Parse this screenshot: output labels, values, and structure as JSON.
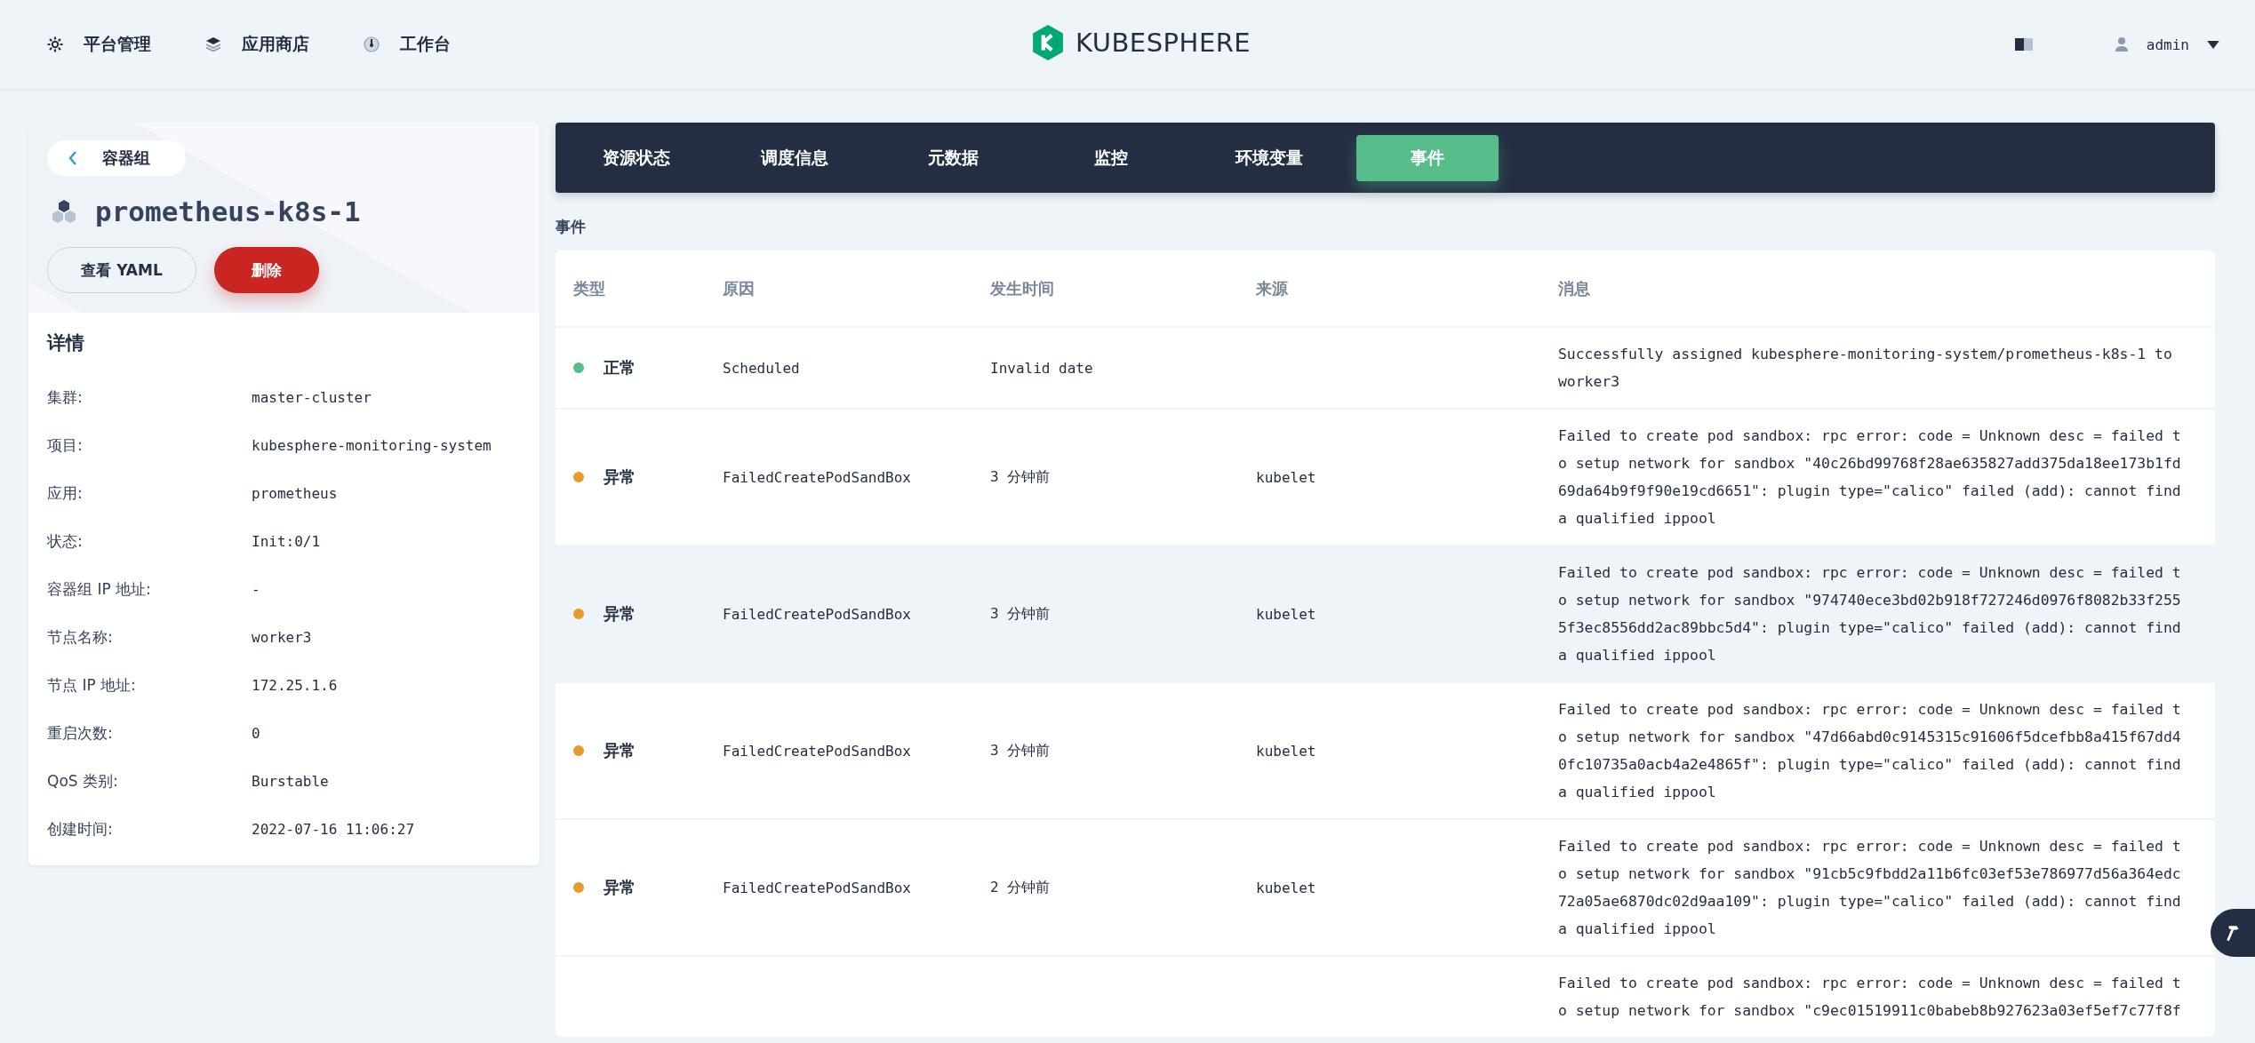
{
  "top_nav": {
    "items": [
      {
        "label": "平台管理",
        "kind": "gear"
      },
      {
        "label": "应用商店",
        "kind": "layers"
      },
      {
        "label": "工作台",
        "kind": "dial"
      }
    ],
    "logo": "KUBESPHERE",
    "user": "admin"
  },
  "sidebar": {
    "back_label": "容器组",
    "title": "prometheus-k8s-1",
    "buttons": [
      {
        "label": "查看 YAML",
        "kind": "default"
      },
      {
        "label": "删除",
        "kind": "danger"
      }
    ],
    "details_title": "详情",
    "details": [
      {
        "label": "集群:",
        "value": "master-cluster"
      },
      {
        "label": "项目:",
        "value": "kubesphere-monitoring-system"
      },
      {
        "label": "应用:",
        "value": "prometheus"
      },
      {
        "label": "状态:",
        "value": "Init:0/1"
      },
      {
        "label": "容器组 IP 地址:",
        "value": "-"
      },
      {
        "label": "节点名称:",
        "value": "worker3"
      },
      {
        "label": "节点 IP 地址:",
        "value": "172.25.1.6"
      },
      {
        "label": "重启次数:",
        "value": "0"
      },
      {
        "label": "QoS 类别:",
        "value": "Burstable"
      },
      {
        "label": "创建时间:",
        "value": "2022-07-16 11:06:27"
      }
    ]
  },
  "tabs": [
    {
      "label": "资源状态",
      "selected": false
    },
    {
      "label": "调度信息",
      "selected": false
    },
    {
      "label": "元数据",
      "selected": false
    },
    {
      "label": "监控",
      "selected": false
    },
    {
      "label": "环境变量",
      "selected": false
    },
    {
      "label": "事件",
      "selected": true
    }
  ],
  "section_title": "事件",
  "table": {
    "columns": [
      "类型",
      "原因",
      "发生时间",
      "来源",
      "消息"
    ],
    "rows": [
      {
        "type": "正常",
        "color": "#55bc8a",
        "reason": "Scheduled",
        "time": "Invalid date",
        "source": "",
        "message": "Successfully assigned kubesphere-monitoring-system/prometheus-k8s-1 to worker3",
        "highlighted": false
      },
      {
        "type": "异常",
        "color": "#e89b2c",
        "reason": "FailedCreatePodSandBox",
        "time": "3 分钟前",
        "source": "kubelet",
        "message": "Failed to create pod sandbox: rpc error: code = Unknown desc = failed to setup network for sandbox \"40c26bd99768f28ae635827add375da18ee173b1fd69da64b9f9f90e19cd6651\": plugin type=\"calico\" failed (add): cannot find a qualified ippool",
        "highlighted": false
      },
      {
        "type": "异常",
        "color": "#e89b2c",
        "reason": "FailedCreatePodSandBox",
        "time": "3 分钟前",
        "source": "kubelet",
        "message": "Failed to create pod sandbox: rpc error: code = Unknown desc = failed to setup network for sandbox \"974740ece3bd02b918f727246d0976f8082b33f2555f3ec8556dd2ac89bbc5d4\": plugin type=\"calico\" failed (add): cannot find a qualified ippool",
        "highlighted": true
      },
      {
        "type": "异常",
        "color": "#e89b2c",
        "reason": "FailedCreatePodSandBox",
        "time": "3 分钟前",
        "source": "kubelet",
        "message": "Failed to create pod sandbox: rpc error: code = Unknown desc = failed to setup network for sandbox \"47d66abd0c9145315c91606f5dcefbb8a415f67dd40fc10735a0acb4a2e4865f\": plugin type=\"calico\" failed (add): cannot find a qualified ippool",
        "highlighted": false
      },
      {
        "type": "异常",
        "color": "#e89b2c",
        "reason": "FailedCreatePodSandBox",
        "time": "2 分钟前",
        "source": "kubelet",
        "message": "Failed to create pod sandbox: rpc error: code = Unknown desc = failed to setup network for sandbox \"91cb5c9fbdd2a11b6fc03ef53e786977d56a364edc72a05ae6870dc02d9aa109\": plugin type=\"calico\" failed (add): cannot find a qualified ippool",
        "highlighted": false
      },
      {
        "message": "Failed to create pod sandbox: rpc error: code = Unknown desc = failed to setup network for sandbox \"c9ec01519911c0babeb8b927623a03ef5ef7c77f8f",
        "highlighted": false
      }
    ]
  }
}
